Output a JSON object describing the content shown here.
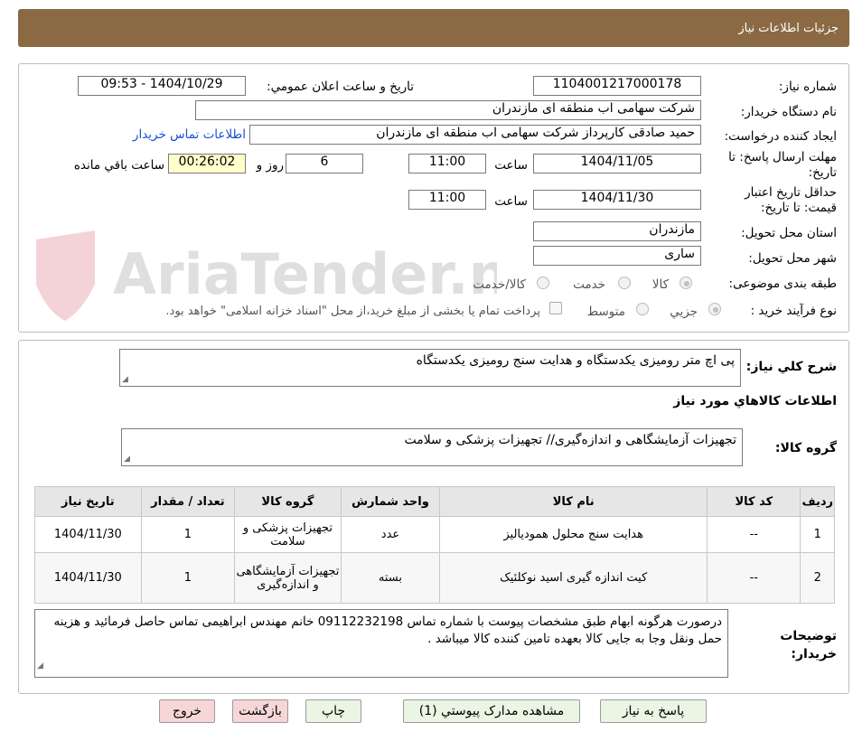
{
  "header": {
    "title": "جزئیات اطلاعات نیاز"
  },
  "fields": {
    "need_number_label": "شماره نیاز:",
    "need_number": "1104001217000178",
    "announce_label": "تاریخ و ساعت اعلان عمومي:",
    "announce_value": "1404/10/29 - 09:53",
    "buyer_label": "نام دستگاه خریدار:",
    "buyer_value": "شرکت سهامی اب منطقه ای مازندران",
    "creator_label": "ایجاد کننده درخواست:",
    "creator_value": "حمید  صادقی کارپرداز شرکت سهامی اب منطقه ای مازندران",
    "contact_link": "اطلاعات تماس خریدار",
    "deadline_label": "مهلت ارسال پاسخ: تا تاریخ:",
    "deadline_date": "1404/11/05",
    "time_label": "ساعت",
    "deadline_time": "11:00",
    "days_value": "6",
    "days_label": "روز و",
    "remaining_value": "00:26:02",
    "remaining_label": "ساعت باقي مانده",
    "validity_label": "حداقل تاریخ اعتبار قیمت: تا تاریخ:",
    "validity_date": "1404/11/30",
    "validity_time": "11:00",
    "province_label": "استان محل تحویل:",
    "province_value": "مازندران",
    "city_label": "شهر محل تحویل:",
    "city_value": "ساری",
    "category_label": "طبقه بندی موضوعی:",
    "category_options": [
      "کالا",
      "خدمت",
      "کالا/خدمت"
    ],
    "process_label": "نوع فرآیند خرید :",
    "process_options": [
      "جزیي",
      "متوسط"
    ],
    "process_note": "پرداخت تمام یا بخشی از مبلغ خرید،از محل \"اسناد خزانه اسلامی\" خواهد بود."
  },
  "summary": {
    "label": "شرح کلي نیاز:",
    "value": "پی اچ متر رومیزی یکدستگاه و هدایت سنج رومیزی یکدستگاه",
    "goods_info_title": "اطلاعات کالاهاي مورد نیاز",
    "group_label": "گروه کالا:",
    "group_value": "تجهیزات آزمایشگاهی و اندازه‌گیری// تجهیزات پزشکی و سلامت"
  },
  "table": {
    "headers": [
      "ردیف",
      "کد کالا",
      "نام کالا",
      "واحد شمارش",
      "گروه کالا",
      "تعداد / مقدار",
      "تاریخ نیاز"
    ],
    "rows": [
      [
        "1",
        "--",
        "هدایت سنج محلول همودیالیز",
        "عدد",
        "تجهیزات پزشکی و سلامت",
        "1",
        "1404/11/30"
      ],
      [
        "2",
        "--",
        "کیت اندازه گیری اسید نوکلئیک",
        "بسته",
        "تجهیزات آزمایشگاهی و اندازه‌گیری",
        "1",
        "1404/11/30"
      ]
    ]
  },
  "buyer_notes": {
    "label": "توضیحات خریدار:",
    "value": "درصورت هرگونه ابهام طبق مشخصات پیوست با شماره تماس 09112232198 خانم مهندس ابراهیمی تماس حاصل فرمائید و هزینه حمل ونقل وجا به جایی کالا بعهده تامین کننده کالا میباشد ."
  },
  "buttons": {
    "reply": "پاسخ به نیاز",
    "attachments": "مشاهده مدارک پیوستي (1)",
    "print": "چاپ",
    "back": "بازگشت",
    "exit": "خروج"
  },
  "watermark": {
    "text": "AriaTender.neT"
  },
  "colors": {
    "header": "#8b6a43",
    "button": "#eaf5e4",
    "button_red": "#f6d6d6",
    "remaining": "#ffffcc"
  }
}
